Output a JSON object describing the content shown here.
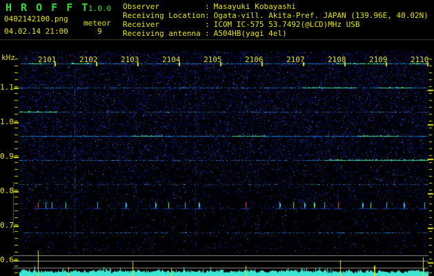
{
  "header": {
    "title": "H R O F F T",
    "version": "1.0.0",
    "filename": "0402142100.png",
    "mode": "meteor",
    "datetime": "04.02.14 21:00",
    "count": "9",
    "info_separator": ":",
    "info": [
      {
        "label": "Observer",
        "value": "Masayuki Kobayashi"
      },
      {
        "label": "Receiving Location",
        "value": "Ogata-vill. Akita-Pref. JAPAN (139.96E, 40.02N)"
      },
      {
        "label": "Receiver",
        "value": "ICOM IC-575 53.7492(@LCD)MHz USB"
      },
      {
        "label": "Receiving antenna",
        "value": "A504HB(yagi 4el)"
      }
    ]
  },
  "chart_data": {
    "type": "heatmap",
    "subtype": "radio-spectrogram",
    "ylabel_unit": "kHz",
    "y_ticks": [
      "1.1",
      "1.0",
      "0.9",
      "0.8",
      "0.7",
      "0.6"
    ],
    "y_range_khz": [
      0.59,
      1.2
    ],
    "x_ticks": [
      "2101",
      "2102",
      "2103",
      "2104",
      "2105",
      "2106",
      "2107",
      "2108",
      "2109",
      "2110"
    ],
    "x_axis_desc": "time HHMM from 21:01 to 21:10",
    "grid": false,
    "carrier_lines": [
      {
        "khz": 1.17,
        "level": 0.75,
        "bright_minutes": [
          [
            0.4,
            0.7
          ],
          [
            1.4,
            1.9
          ],
          [
            7.8,
            9.0
          ],
          [
            9.6,
            10.0
          ]
        ]
      },
      {
        "khz": 1.1,
        "level": 0.5,
        "bright_minutes": [
          [
            7.0,
            8.3
          ],
          [
            8.8,
            9.6
          ]
        ]
      },
      {
        "khz": 1.03,
        "level": 0.38,
        "bright_minutes": [
          [
            0.15,
            1.05
          ]
        ]
      },
      {
        "khz": 0.96,
        "level": 0.8,
        "bright_minutes": [
          [
            2.9,
            3.6
          ],
          [
            5.3,
            6.1
          ],
          [
            8.3,
            9.3
          ]
        ]
      },
      {
        "khz": 0.89,
        "level": 0.42,
        "bright_minutes": [
          [
            7.5,
            10.0
          ]
        ]
      },
      {
        "khz": 0.82,
        "level": 0.22,
        "bright_minutes": []
      },
      {
        "khz": 0.68,
        "level": 0.32,
        "bright_minutes": []
      }
    ],
    "echo_row_khz": 0.76,
    "echoes": [
      {
        "minute": 0.6,
        "color": "#ff5040"
      },
      {
        "minute": 0.78
      },
      {
        "minute": 0.93
      },
      {
        "minute": 1.27,
        "color": "#50ff50"
      },
      {
        "minute": 2.03
      },
      {
        "minute": 2.72
      },
      {
        "minute": 3.43
      },
      {
        "minute": 3.75,
        "color": "#50ff50"
      },
      {
        "minute": 4.15
      },
      {
        "minute": 4.48
      },
      {
        "minute": 5.62,
        "color": "#ff5040"
      },
      {
        "minute": 6.43
      },
      {
        "minute": 6.77,
        "color": "#50ff50"
      },
      {
        "minute": 7.03
      },
      {
        "minute": 7.27,
        "color": "#50ff50"
      },
      {
        "minute": 7.52
      },
      {
        "minute": 7.85,
        "color": "#ff5040"
      },
      {
        "minute": 8.43
      },
      {
        "minute": 8.63,
        "color": "#50ff50"
      },
      {
        "minute": 9.02
      },
      {
        "minute": 9.43
      },
      {
        "minute": 9.93
      }
    ],
    "interference_streaks": [
      {
        "minute": 1.48,
        "level": 0.45
      },
      {
        "minute": 4.4,
        "level": 0.18
      }
    ],
    "level_spikes": [
      {
        "minute": 0.6,
        "h": 36
      },
      {
        "minute": 1.33,
        "h": 12
      },
      {
        "minute": 2.88,
        "h": 20
      },
      {
        "minute": 3.82,
        "h": 10
      },
      {
        "minute": 5.62,
        "h": 14
      },
      {
        "minute": 7.9,
        "h": 22
      },
      {
        "minute": 8.72,
        "h": 14,
        "w": 2
      },
      {
        "minute": 9.9,
        "h": 26
      }
    ]
  },
  "colors": {
    "title_green": "#2ee02e",
    "text_yellow": "#e6e600",
    "separator": "#3a3a28",
    "noise_palette": [
      "#000a64",
      "#0a1e96",
      "#1e3cc8",
      "#3c64e6",
      "#6ea0ff",
      "#00e6ff"
    ],
    "line_blue": "#1478e6",
    "line_cyan": "#28b4f0",
    "line_bright": "#3ce6a0",
    "line_bright2": "#64f078",
    "streak_blue": "#1e46c8",
    "echo_connector": "#0a3ca0",
    "gray_line": "#909090",
    "axis_gray": "#5a5a5a",
    "waveform": "#3ce6d2",
    "spike_yellow": "#e6e600",
    "echo_default": "#30c8ff"
  }
}
